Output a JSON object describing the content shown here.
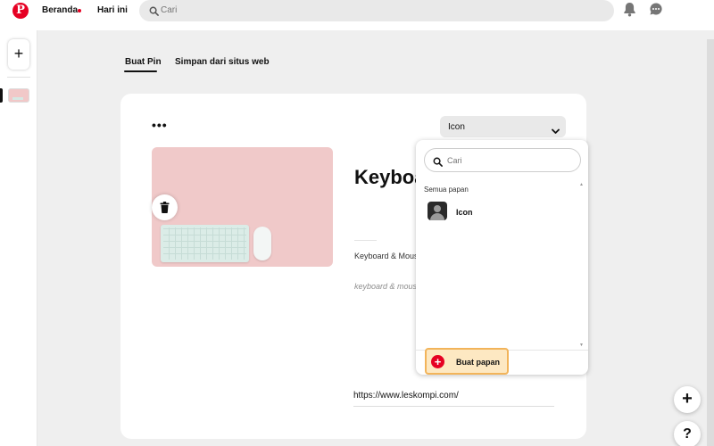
{
  "header": {
    "nav_home": "Beranda",
    "nav_today": "Hari ini",
    "search_placeholder": "Cari",
    "icons": [
      "pinterest-logo",
      "search-icon",
      "bell-icon",
      "chat-icon"
    ]
  },
  "rail": {
    "add_label": "+"
  },
  "tabs": [
    {
      "label": "Buat Pin",
      "active": true
    },
    {
      "label": "Simpan dari situs web",
      "active": false
    }
  ],
  "pin": {
    "more_label": "•••",
    "board_selected": "Icon",
    "title": "Keyboard & Mouse",
    "description": "Keyboard & Mouse",
    "tags": "keyboard & mouse",
    "link": "https://www.leskompi.com/"
  },
  "dropdown": {
    "search_placeholder": "Cari",
    "section_label": "Semua papan",
    "boards": [
      {
        "name": "Icon"
      }
    ],
    "create_label": "Buat papan"
  },
  "fabs": {
    "add_label": "+",
    "help_label": "?"
  },
  "colors": {
    "brand": "#e60023",
    "highlight": "#fde8c2",
    "highlight_border": "#f2b45a"
  }
}
